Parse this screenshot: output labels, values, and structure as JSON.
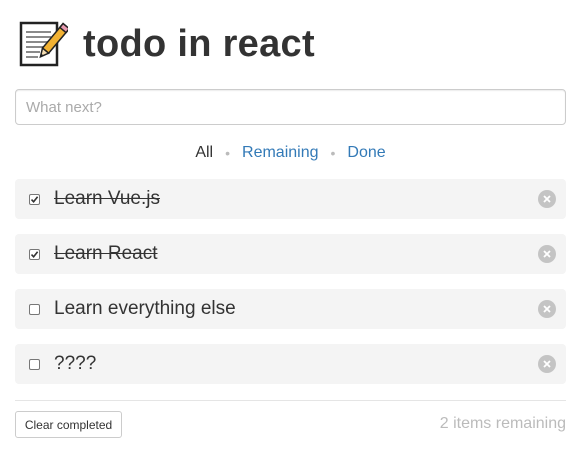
{
  "header": {
    "icon": "memo-icon",
    "title": "todo in react"
  },
  "new_todo": {
    "placeholder": "What next?",
    "value": ""
  },
  "filters": {
    "all": "All",
    "remaining": "Remaining",
    "done": "Done",
    "separator": "•",
    "active": "all"
  },
  "todos": [
    {
      "text": "Learn Vue.js",
      "done": true
    },
    {
      "text": "Learn React",
      "done": true
    },
    {
      "text": "Learn everything else",
      "done": false
    },
    {
      "text": "????",
      "done": false
    }
  ],
  "footer": {
    "clear_label": "Clear completed",
    "remaining_text": "2 items remaining"
  },
  "colors": {
    "link": "#337ab7",
    "item_background": "#f4f4f4",
    "muted": "#bbbbbb",
    "remove_icon": "#c4c4c4"
  }
}
